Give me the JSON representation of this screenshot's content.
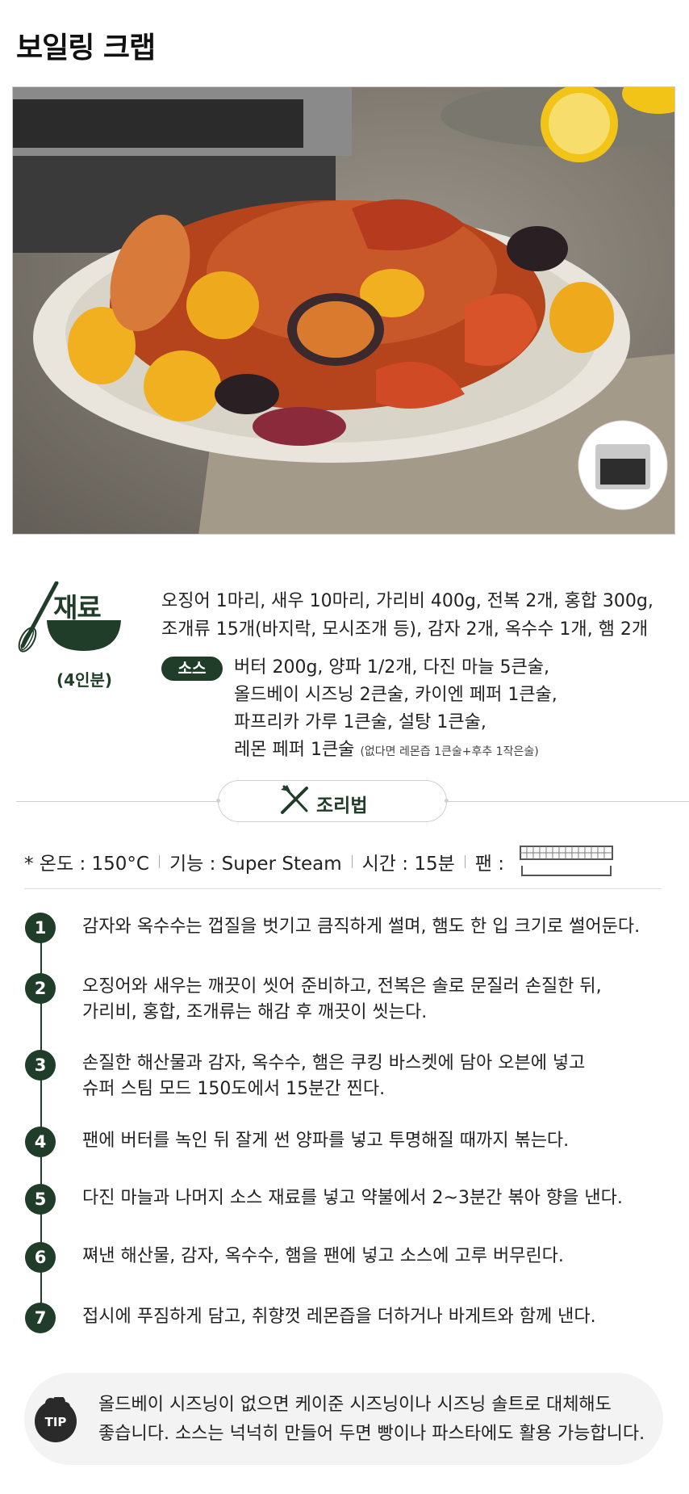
{
  "page_title": "보일링 크랩",
  "ingredients": {
    "header": "재료",
    "servings": "(4인분)",
    "main_line1": "오징어 1마리, 새우 10마리, 가리비 400g, 전복 2개, 홍합 300g,",
    "main_line2": "조개류 15개(바지락, 모시조개 등), 감자 2개, 옥수수 1개, 햄 2개",
    "sauce_label": "소스",
    "sauce_line1": "버터 200g, 양파 1/2개, 다진 마늘 5큰술,",
    "sauce_line2": "올드베이 시즈닝 2큰술, 카이엔 페퍼 1큰술,",
    "sauce_line3": "파프리카 가루 1큰술, 설탕 1큰술,",
    "sauce_line4": "레몬 페퍼 1큰술",
    "sauce_note": "(없다면 레몬즙 1큰술+후추 1작은술)"
  },
  "method": {
    "label": "조리법"
  },
  "settings": {
    "temp": "* 온도 : 150°C",
    "function": "기능 : Super Steam",
    "time": "시간 : 15분",
    "pan": "팬 :"
  },
  "steps": [
    {
      "num": "1",
      "line1": "감자와 옥수수는 껍질을 벗기고 큼직하게 썰며, 햄도 한 입 크기로 썰어둔다.",
      "line2": ""
    },
    {
      "num": "2",
      "line1": "오징어와 새우는 깨끗이 씻어 준비하고, 전복은 솔로 문질러 손질한 뒤,",
      "line2": "가리비, 홍합, 조개류는 해감 후 깨끗이 씻는다."
    },
    {
      "num": "3",
      "line1": "손질한 해산물과 감자, 옥수수, 햄은 쿠킹 바스켓에 담아 오븐에 넣고",
      "line2": "슈퍼 스팀 모드 150도에서 15분간 찐다."
    },
    {
      "num": "4",
      "line1": "팬에 버터를 녹인 뒤 잘게 썬 양파를 넣고 투명해질 때까지 볶는다.",
      "line2": ""
    },
    {
      "num": "5",
      "line1": "다진 마늘과 나머지 소스 재료를 넣고 약불에서 2~3분간 볶아 향을 낸다.",
      "line2": ""
    },
    {
      "num": "6",
      "line1": "쪄낸 해산물, 감자, 옥수수, 햄을 팬에 넣고 소스에 고루 버무린다.",
      "line2": ""
    },
    {
      "num": "7",
      "line1": "접시에 푸짐하게 담고, 취향껏 레몬즙을 더하거나 바게트와 함께 낸다.",
      "line2": ""
    }
  ],
  "tip": {
    "badge": "TIP",
    "line1": "올드베이 시즈닝이 없으면 케이준 시즈닝이나 시즈닝 솔트로 대체해도",
    "line2": "좋습니다. 소스는 넉넉히 만들어 두면 빵이나 파스타에도 활용 가능합니다."
  },
  "colors": {
    "brand_green": "#1f3d28"
  }
}
